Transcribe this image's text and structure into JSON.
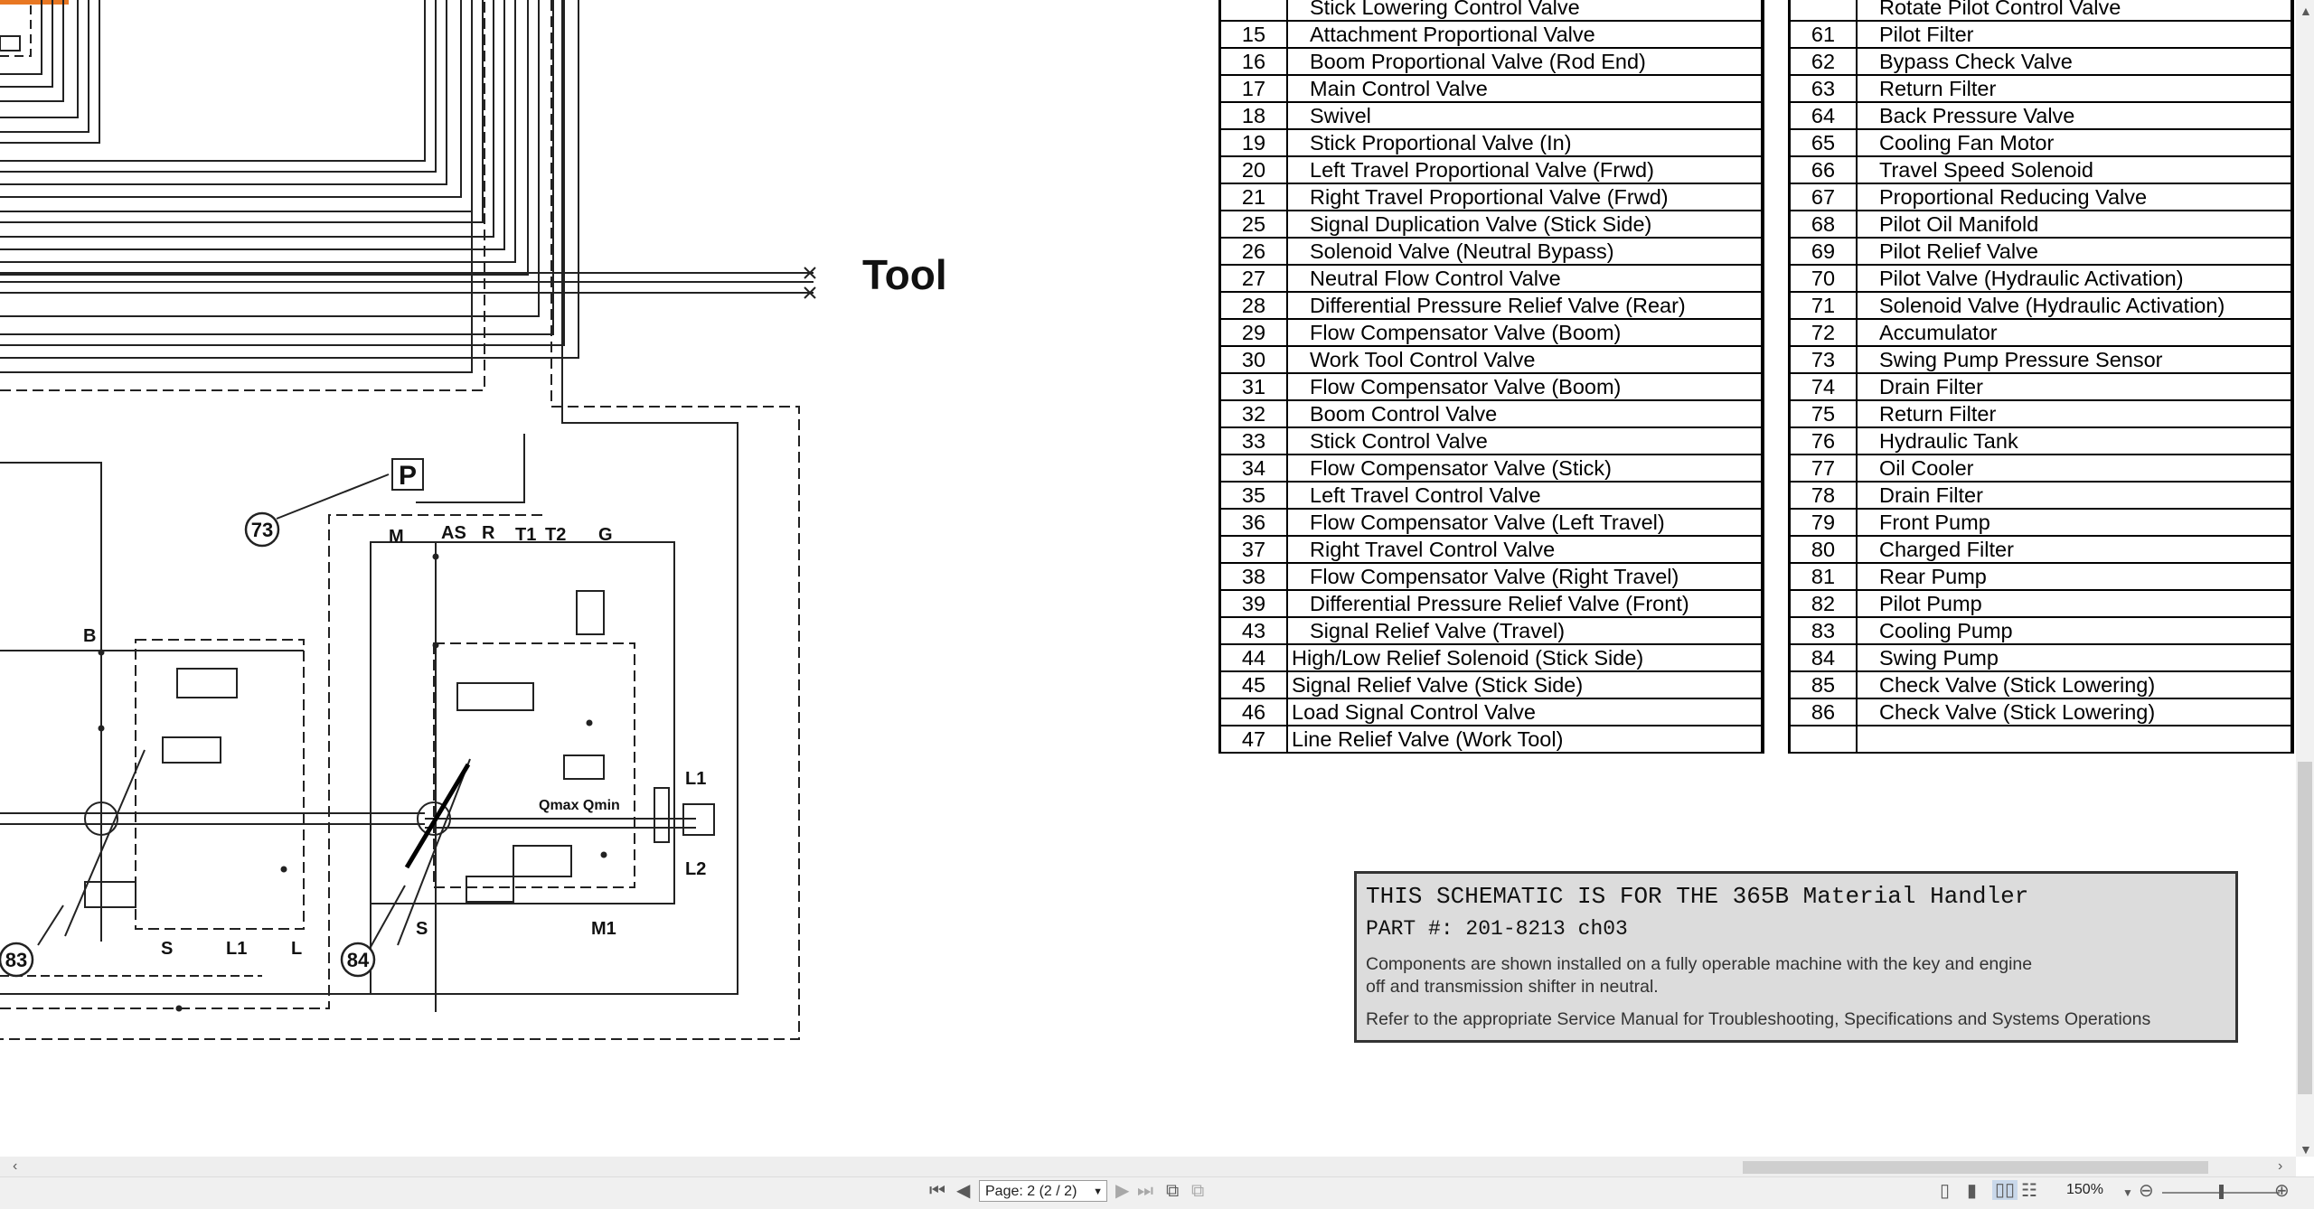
{
  "diagram": {
    "tool_label": "Tool",
    "pressure_label": "P",
    "callouts": [
      "73",
      "83",
      "84"
    ],
    "port_labels": {
      "m": "M",
      "as": "AS",
      "r": "R",
      "t1": "T1",
      "t2": "T2",
      "g": "G",
      "b": "B",
      "s_left": "S",
      "l1_left": "L1",
      "l_left": "L",
      "s_right": "S",
      "m1": "M1",
      "l1_right": "L1",
      "l2_right": "L2",
      "qmax_qmin": "Qmax Qmin"
    }
  },
  "parts_table_left": {
    "top_partial": "Stick Lowering Control Valve",
    "rows": [
      {
        "num": "15",
        "desc": "Attachment Proportional Valve"
      },
      {
        "num": "16",
        "desc": "Boom Proportional Valve (Rod End)"
      },
      {
        "num": "17",
        "desc": "Main Control Valve"
      },
      {
        "num": "18",
        "desc": "Swivel"
      },
      {
        "num": "19",
        "desc": "Stick Proportional Valve (In)"
      },
      {
        "num": "20",
        "desc": "Left Travel Proportional Valve (Frwd)"
      },
      {
        "num": "21",
        "desc": "Right Travel Proportional Valve (Frwd)"
      },
      {
        "num": "25",
        "desc": "Signal Duplication Valve (Stick Side)"
      },
      {
        "num": "26",
        "desc": "Solenoid Valve (Neutral Bypass)"
      },
      {
        "num": "27",
        "desc": "Neutral Flow Control Valve"
      },
      {
        "num": "28",
        "desc": "Differential Pressure Relief Valve (Rear)"
      },
      {
        "num": "29",
        "desc": "Flow Compensator Valve (Boom)"
      },
      {
        "num": "30",
        "desc": "Work Tool Control Valve"
      },
      {
        "num": "31",
        "desc": "Flow Compensator Valve (Boom)"
      },
      {
        "num": "32",
        "desc": "Boom Control Valve"
      },
      {
        "num": "33",
        "desc": "Stick Control Valve"
      },
      {
        "num": "34",
        "desc": "Flow Compensator Valve (Stick)"
      },
      {
        "num": "35",
        "desc": "Left Travel Control Valve"
      },
      {
        "num": "36",
        "desc": "Flow Compensator Valve (Left Travel)"
      },
      {
        "num": "37",
        "desc": "Right Travel Control Valve"
      },
      {
        "num": "38",
        "desc": "Flow Compensator Valve (Right Travel)"
      },
      {
        "num": "39",
        "desc": "Differential Pressure Relief Valve (Front)"
      },
      {
        "num": "43",
        "desc": "Signal Relief Valve (Travel)"
      },
      {
        "num": "44",
        "desc": "High/Low Relief Solenoid (Stick Side)"
      },
      {
        "num": "45",
        "desc": "Signal Relief Valve (Stick Side)"
      },
      {
        "num": "46",
        "desc": "Load Signal Control Valve"
      },
      {
        "num": "47",
        "desc": "Line Relief Valve (Work Tool)"
      }
    ]
  },
  "parts_table_right": {
    "top_partial": "Rotate Pilot Control Valve",
    "rows": [
      {
        "num": "61",
        "desc": "Pilot Filter"
      },
      {
        "num": "62",
        "desc": "Bypass Check Valve"
      },
      {
        "num": "63",
        "desc": "Return Filter"
      },
      {
        "num": "64",
        "desc": "Back Pressure Valve"
      },
      {
        "num": "65",
        "desc": "Cooling Fan Motor"
      },
      {
        "num": "66",
        "desc": "Travel Speed Solenoid"
      },
      {
        "num": "67",
        "desc": "Proportional Reducing Valve"
      },
      {
        "num": "68",
        "desc": "Pilot Oil Manifold"
      },
      {
        "num": "69",
        "desc": "Pilot Relief Valve"
      },
      {
        "num": "70",
        "desc": "Pilot Valve (Hydraulic Activation)"
      },
      {
        "num": "71",
        "desc": "Solenoid Valve (Hydraulic Activation)"
      },
      {
        "num": "72",
        "desc": "Accumulator"
      },
      {
        "num": "73",
        "desc": "Swing Pump Pressure Sensor"
      },
      {
        "num": "74",
        "desc": "Drain Filter"
      },
      {
        "num": "75",
        "desc": "Return Filter"
      },
      {
        "num": "76",
        "desc": "Hydraulic Tank"
      },
      {
        "num": "77",
        "desc": "Oil Cooler"
      },
      {
        "num": "78",
        "desc": "Drain Filter"
      },
      {
        "num": "79",
        "desc": "Front Pump"
      },
      {
        "num": "80",
        "desc": "Charged Filter"
      },
      {
        "num": "81",
        "desc": "Rear Pump"
      },
      {
        "num": "82",
        "desc": "Pilot Pump"
      },
      {
        "num": "83",
        "desc": "Cooling Pump"
      },
      {
        "num": "84",
        "desc": "Swing Pump"
      },
      {
        "num": "85",
        "desc": "Check Valve (Stick Lowering)"
      },
      {
        "num": "86",
        "desc": "Check Valve (Stick Lowering)"
      },
      {
        "num": "",
        "desc": ""
      }
    ]
  },
  "note": {
    "line1": "THIS SCHEMATIC IS FOR THE 365B Material Handler",
    "line2": "PART #: 201-8213 ch03",
    "para1": "Components are shown installed on a fully operable machine with the key and engine off and transmission shifter in neutral.",
    "para2": "Refer to the appropriate Service Manual for Troubleshooting, Specifications and Systems Operations"
  },
  "viewer": {
    "page_indicator": "Page: 2 (2 / 2)",
    "zoom": "150%"
  }
}
